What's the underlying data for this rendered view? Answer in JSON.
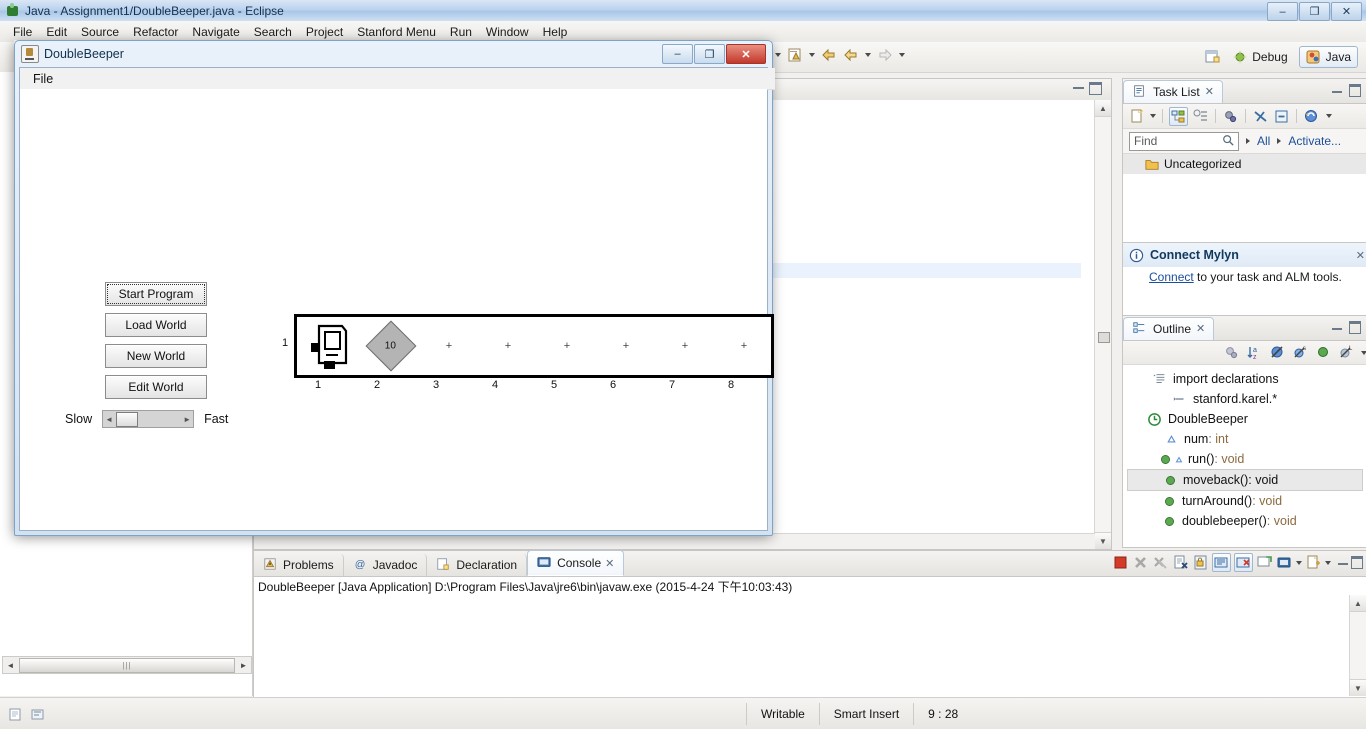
{
  "eclipse": {
    "title": "Java - Assignment1/DoubleBeeper.java - Eclipse",
    "app_icon": "eclipse-icon",
    "window_controls": {
      "minimize": "–",
      "maximize": "❐",
      "close": "✕"
    },
    "menus": [
      "File",
      "Edit",
      "Source",
      "Refactor",
      "Navigate",
      "Search",
      "Project",
      "Stanford Menu",
      "Run",
      "Window",
      "Help"
    ],
    "perspectives": [
      {
        "label": "Debug",
        "icon": "debug-perspective-icon",
        "active": false
      },
      {
        "label": "Java",
        "icon": "java-perspective-icon",
        "active": true
      }
    ],
    "open_perspective_icon": "open-perspective-icon"
  },
  "editor": {
    "minimize_icon": "minimize-icon",
    "maximize_icon": "maximize-icon",
    "scroll_up_icon": "▲",
    "scroll_down_icon": "▼"
  },
  "console": {
    "tabs": [
      {
        "label": "Problems",
        "icon": "problems-icon",
        "active": false
      },
      {
        "label": "Javadoc",
        "icon": "javadoc-icon",
        "active": false
      },
      {
        "label": "Declaration",
        "icon": "declaration-icon",
        "active": false
      },
      {
        "label": "Console",
        "icon": "console-icon",
        "active": true
      }
    ],
    "close_icon": "✕",
    "launch_info": "DoubleBeeper [Java Application] D:\\Program Files\\Java\\jre6\\bin\\javaw.exe (2015-4-24 下午10:03:43)",
    "toolbar_icons": [
      "terminate-icon",
      "remove-launch-icon",
      "remove-all-terminated-icon",
      "clear-console-icon",
      "lock-scroll-icon",
      "scroll-lock-icon",
      "pin-console-icon",
      "display-selected-console-icon",
      "open-console-icon",
      "view-menu-icon"
    ]
  },
  "task_list": {
    "tab_label": "Task List",
    "tab_icon": "task-list-icon",
    "close_icon": "✕",
    "toolbar_icons": [
      "new-task-icon",
      "dropdown-arrow-icon",
      "categorized-icon",
      "scheduled-icon",
      "focus-icon",
      "collapse-all-icon",
      "filter-icon",
      "synchronize-icon",
      "view-menu-icon"
    ],
    "find_placeholder": "Find",
    "find_value": "",
    "search_icon": "search-icon",
    "filters": [
      "All",
      "Activate..."
    ],
    "rows": [
      {
        "label": "Uncategorized",
        "icon": "folder-icon"
      }
    ]
  },
  "mylyn": {
    "title": "Connect Mylyn",
    "info_icon": "info-icon",
    "close_icon": "✕",
    "link_text": "Connect",
    "body_text": " to your task and ALM tools."
  },
  "outline": {
    "tab_label": "Outline",
    "tab_icon": "outline-icon",
    "close_icon": "✕",
    "toolbar_icons": [
      "focus-on-active-icon",
      "sort-alphabetically-icon",
      "hide-fields-icon",
      "hide-static-icon",
      "hide-nonpublic-icon",
      "hide-local-types-icon",
      "view-menu-icon"
    ],
    "items": [
      {
        "label": "import declarations",
        "icon": "import-declarations-icon",
        "indent": 0,
        "type": "",
        "selected": false
      },
      {
        "label": "stanford.karel.*",
        "icon": "import-icon",
        "indent": 1,
        "type": "",
        "selected": false
      },
      {
        "label": "DoubleBeeper",
        "icon": "class-icon",
        "indent": 0,
        "type": "",
        "selected": false
      },
      {
        "label": "num",
        "icon": "field-icon",
        "indent": 1,
        "type": " : int",
        "selected": false
      },
      {
        "label": "run()",
        "icon": "method-public-icon",
        "indent": 1,
        "type": " : void",
        "selected": false
      },
      {
        "label": "moveback()",
        "icon": "method-public-icon",
        "indent": 1,
        "type": " : void",
        "selected": true
      },
      {
        "label": "turnAround()",
        "icon": "method-public-icon",
        "indent": 1,
        "type": " : void",
        "selected": false
      },
      {
        "label": "doublebeeper()",
        "icon": "method-public-icon",
        "indent": 1,
        "type": " : void",
        "selected": false
      }
    ]
  },
  "status_bar": {
    "left_icons": [
      "writable-state-icon",
      "smart-insert-icon"
    ],
    "cells": [
      "Writable",
      "Smart Insert",
      "9 : 28"
    ]
  },
  "karel_window": {
    "title": "DoubleBeeper",
    "app_icon": "java-coffee-icon",
    "controls": {
      "minimize": "–",
      "maximize": "❐",
      "close": "✕"
    },
    "menus": [
      "File"
    ],
    "buttons": [
      {
        "label": "Start Program",
        "focused": true
      },
      {
        "label": "Load World",
        "focused": false
      },
      {
        "label": "New World",
        "focused": false
      },
      {
        "label": "Edit World",
        "focused": false
      }
    ],
    "speed": {
      "slow_label": "Slow",
      "fast_label": "Fast",
      "value_pct": 12,
      "left_arrow": "◄",
      "right_arrow": "►"
    },
    "world": {
      "columns": 8,
      "rows": 1,
      "row_labels": [
        "1"
      ],
      "column_labels": [
        "1",
        "2",
        "3",
        "4",
        "5",
        "6",
        "7",
        "8"
      ],
      "corner_marker": "+",
      "karel": {
        "column": 1,
        "row": 1,
        "direction": "east",
        "icon": "karel-robot-icon"
      },
      "beepers": [
        {
          "column": 2,
          "row": 1,
          "count": "10"
        }
      ]
    }
  }
}
